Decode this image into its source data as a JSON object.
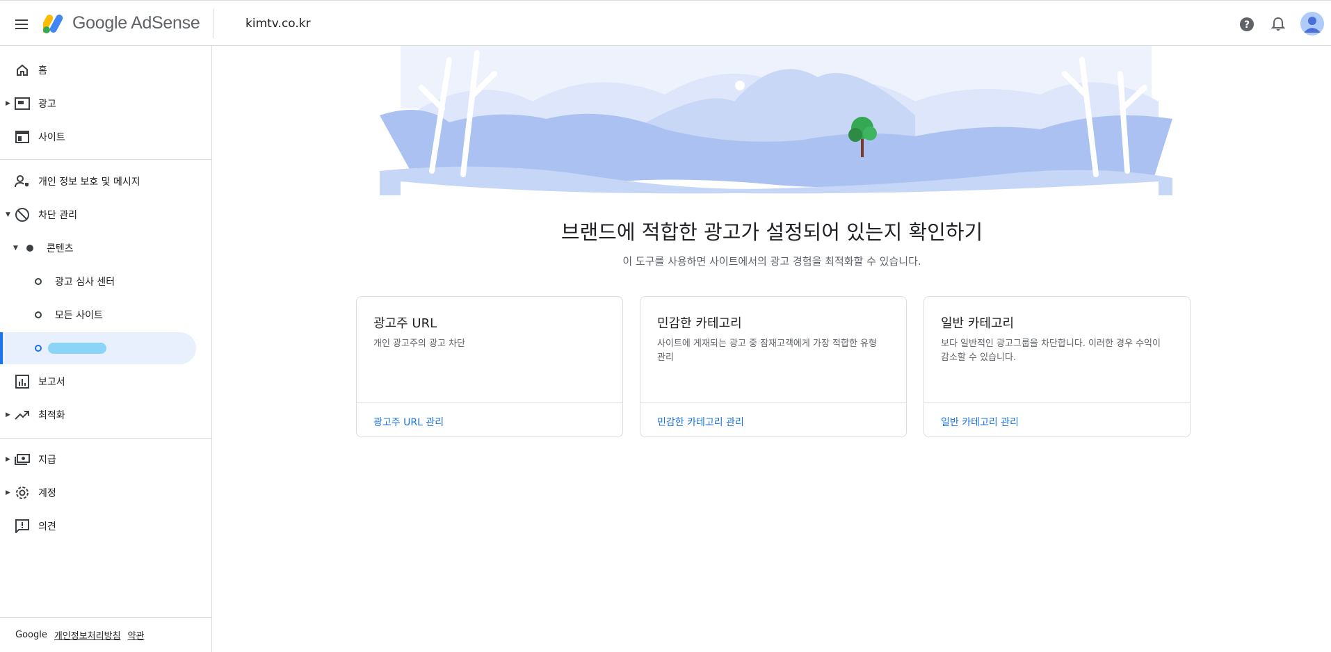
{
  "header": {
    "product_name": "Google AdSense",
    "site_name": "kimtv.co.kr",
    "icons": [
      "menu-icon",
      "help-icon",
      "notifications-icon",
      "account-avatar"
    ]
  },
  "sidebar": {
    "items": [
      {
        "label": "홈",
        "icon": "home-icon"
      },
      {
        "label": "광고",
        "icon": "ads-icon"
      },
      {
        "label": "사이트",
        "icon": "sites-icon"
      },
      {
        "label": "개인 정보 보호 및 메시지",
        "icon": "privacy-icon"
      },
      {
        "label": "차단 관리",
        "icon": "block-icon"
      },
      {
        "label": "콘텐츠",
        "icon": "dot-icon"
      },
      {
        "label": "광고 심사 센터",
        "icon": "circle-icon"
      },
      {
        "label": "모든 사이트",
        "icon": "circle-icon"
      },
      {
        "label": "",
        "icon": "circle-icon"
      },
      {
        "label": "보고서",
        "icon": "reports-icon"
      },
      {
        "label": "최적화",
        "icon": "optimization-icon"
      },
      {
        "label": "지급",
        "icon": "payments-icon"
      },
      {
        "label": "계정",
        "icon": "settings-icon"
      },
      {
        "label": "의견",
        "icon": "feedback-icon"
      }
    ],
    "footer": {
      "brand": "Google",
      "privacy_link": "개인정보처리방침",
      "terms_link": "약관"
    }
  },
  "main": {
    "headline": "브랜드에 적합한 광고가 설정되어 있는지 확인하기",
    "subheadline": "이 도구를 사용하면 사이트에서의 광고 경험을 최적화할 수 있습니다.",
    "cards": [
      {
        "title": "광고주 URL",
        "description": "개인 광고주의 광고 차단",
        "link": "광고주 URL 관리"
      },
      {
        "title": "민감한 카테고리",
        "description": "사이트에 게재되는 광고 중 잠재고객에게 가장 적합한 유형 관리",
        "link": "민감한 카테고리 관리"
      },
      {
        "title": "일반 카테고리",
        "description": "보다 일반적인 광고그룹을 차단합니다. 이러한 경우 수익이 감소할 수 있습니다.",
        "link": "일반 카테고리 관리"
      }
    ]
  },
  "colors": {
    "accent": "#1a73e8",
    "active_bg": "#e8f0fe",
    "illustration_light": "#e8eefc",
    "illustration_mid": "#c6d6f7",
    "illustration_dark": "#a7bff2"
  }
}
